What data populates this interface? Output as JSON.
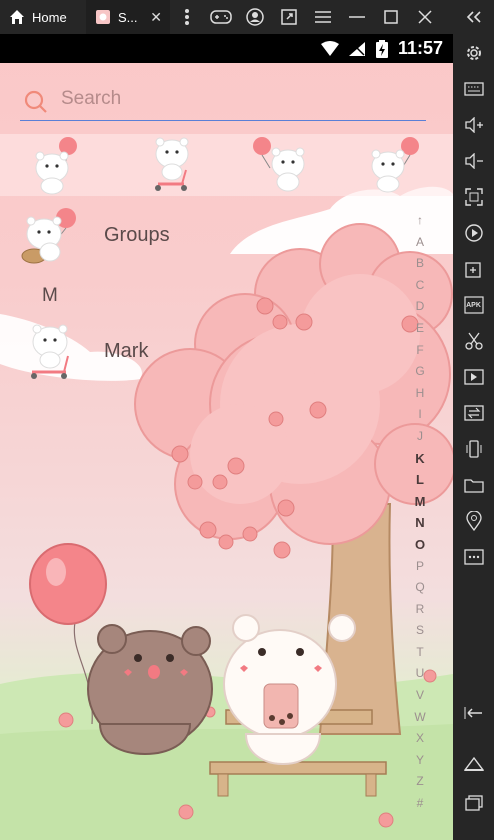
{
  "emulator": {
    "tabs": [
      {
        "label": "Home",
        "icon": "home-icon"
      },
      {
        "label": "S...",
        "icon": "app-thumbnail-icon"
      }
    ],
    "toolbar_icons": [
      "gamepad-icon",
      "account-icon",
      "expand-window-icon",
      "menu-icon",
      "minimize-icon",
      "maximize-icon",
      "close-icon"
    ],
    "sidebar_icons": [
      "collapse-sidebar-icon",
      "settings-icon",
      "keyboard-icon",
      "volume-up-icon",
      "volume-down-icon",
      "screenshot-icon",
      "screen-record-icon",
      "add-app-icon",
      "apk-install-icon",
      "scissors-icon",
      "video-icon",
      "sync-icon",
      "shake-icon",
      "folder-icon",
      "location-icon",
      "more-icon",
      "back-icon",
      "home-icon",
      "recent-apps-icon"
    ],
    "apk_label": "APK"
  },
  "status_bar": {
    "time": "11:57"
  },
  "search": {
    "placeholder": "Search"
  },
  "favorites": [
    "bear-with-balloon",
    "bear-on-scooter",
    "bear-with-balloon",
    "bear-with-balloon"
  ],
  "contacts": [
    {
      "name": "Groups",
      "avatar": "bear-with-basket"
    },
    {
      "section": "M"
    },
    {
      "name": "Mark",
      "avatar": "bear-on-scooter"
    }
  ],
  "index_letters": [
    "↑",
    "A",
    "B",
    "C",
    "D",
    "E",
    "F",
    "G",
    "H",
    "I",
    "J",
    "K",
    "L",
    "M",
    "N",
    "O",
    "P",
    "Q",
    "R",
    "S",
    "T",
    "U",
    "V",
    "W",
    "X",
    "Y",
    "Z",
    "#"
  ],
  "index_active": [
    "K",
    "L",
    "M",
    "N",
    "O"
  ],
  "colors": {
    "accent": "#5a7fd6",
    "search_icon": "#f08a7a",
    "chrome": "#262626"
  }
}
